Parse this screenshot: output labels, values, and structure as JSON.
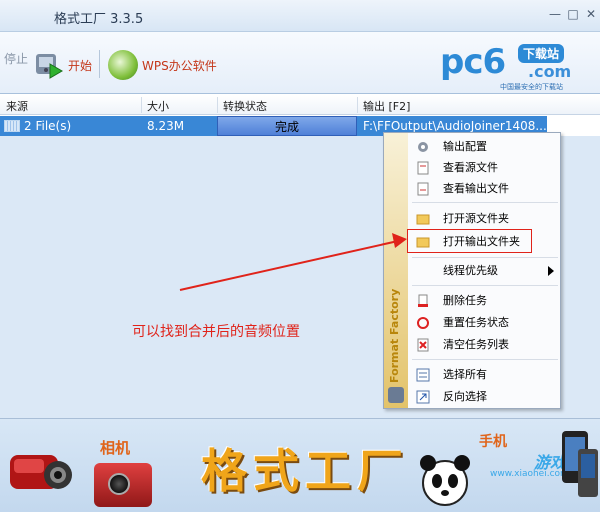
{
  "window": {
    "title": "格式工厂 3.3.5",
    "minimize_glyph": "—",
    "maximize_glyph": "□",
    "close_glyph": "✕"
  },
  "toolbar": {
    "stop_label": "停止",
    "start_label": "开始",
    "wps_label": "WPS办公软件"
  },
  "logo": {
    "brand": "pc6",
    "badge": "下载站",
    "domain": ".com",
    "slogan": "中国最安全的下载站"
  },
  "table": {
    "columns": [
      "来源",
      "大小",
      "转换状态",
      "输出 [F2]"
    ],
    "rows": [
      {
        "source": "2 File(s)",
        "size": "8.23M",
        "status": "完成",
        "output": "F:\\FFOutput\\AudioJoiner1408..."
      }
    ]
  },
  "context_menu": {
    "side_text": "Format Factory",
    "items": [
      {
        "label": "输出配置",
        "icon": "gear-icon"
      },
      {
        "label": "查看源文件",
        "icon": "document-icon"
      },
      {
        "label": "查看输出文件",
        "icon": "document-icon"
      },
      {
        "label": "打开源文件夹",
        "icon": "folder-icon"
      },
      {
        "label": "打开输出文件夹",
        "icon": "folder-icon"
      },
      {
        "label": "线程优先级",
        "icon": "none"
      },
      {
        "label": "删除任务",
        "icon": "delete-icon"
      },
      {
        "label": "重置任务状态",
        "icon": "reset-icon"
      },
      {
        "label": "清空任务列表",
        "icon": "clear-icon"
      },
      {
        "label": "选择所有",
        "icon": "select-all-icon"
      },
      {
        "label": "反向选择",
        "icon": "invert-select-icon"
      }
    ]
  },
  "annotation": {
    "text": "可以找到合并后的音频位置",
    "color": "#e0231a"
  },
  "banner": {
    "camera_label": "相机",
    "phone_label": "手机",
    "title": "格式工厂",
    "game_text": "游戏",
    "site": "www.xiaohei.com"
  },
  "colors": {
    "selection": "#3987d6",
    "list_bg": "#dbe8f6",
    "annotation_red": "#e0231a"
  }
}
